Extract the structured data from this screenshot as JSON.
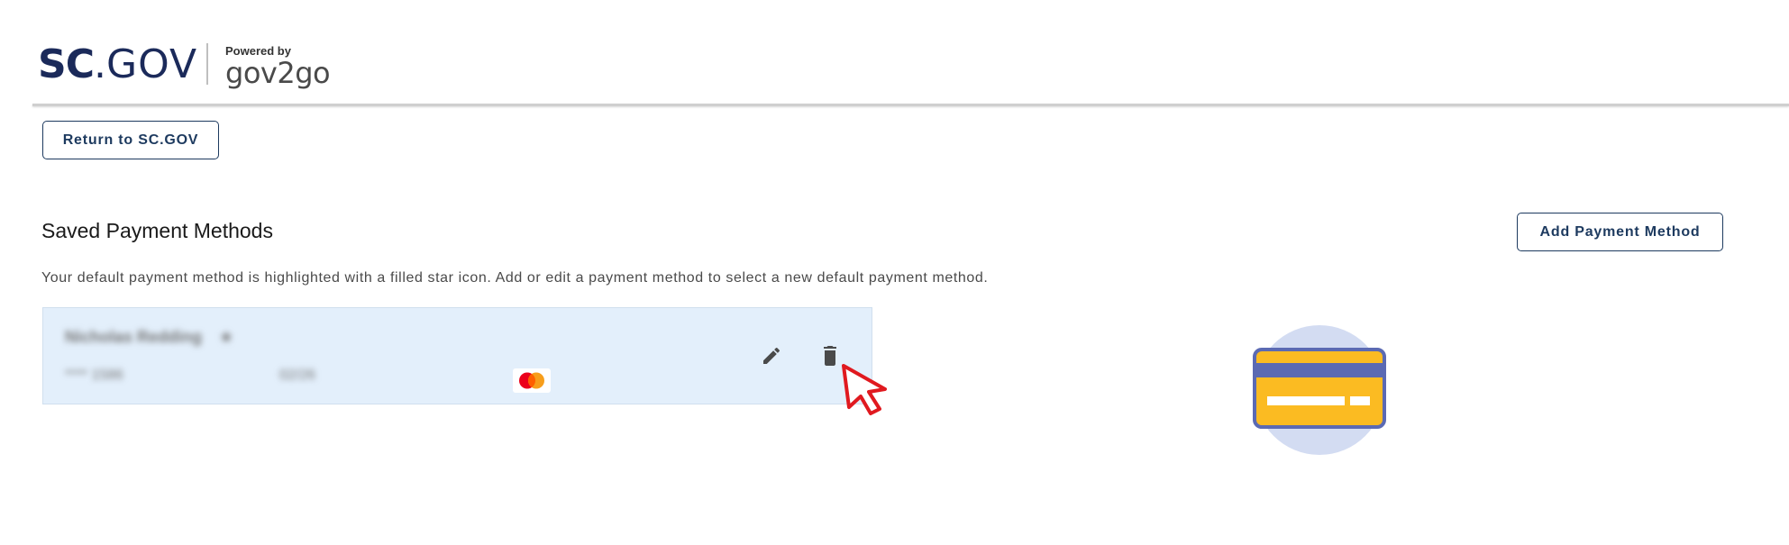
{
  "header": {
    "logo_sc": "SC",
    "logo_dot": ".",
    "logo_gov": "GOV",
    "powered_label": "Powered by",
    "powered_brand": "gov2go"
  },
  "nav": {
    "return_label": "Return to SC.GOV"
  },
  "main": {
    "title": "Saved Payment Methods",
    "add_label": "Add Payment Method",
    "description": "Your default payment method is highlighted with a filled star icon. Add or edit a payment method to select a new default payment method."
  },
  "payment_methods": [
    {
      "name": "Nicholas Redding",
      "number": "**** 1586",
      "expiry": "02/26",
      "card_brand_icon": "mastercard-icon",
      "default_star_icon": "star-icon"
    }
  ],
  "icons": {
    "edit": "pencil-icon",
    "delete": "trash-icon",
    "pointer": "cursor-arrow-icon",
    "illustration": "credit-card-icon"
  },
  "colors": {
    "brand_navy": "#1b2a5a",
    "button_border": "#1d3a5f",
    "card_highlight": "#e3effb",
    "cursor_red": "#e0191f",
    "illustration_yellow": "#fbbb22",
    "illustration_blue": "#5b6ab3",
    "illustration_circle": "#d3dcf2"
  }
}
